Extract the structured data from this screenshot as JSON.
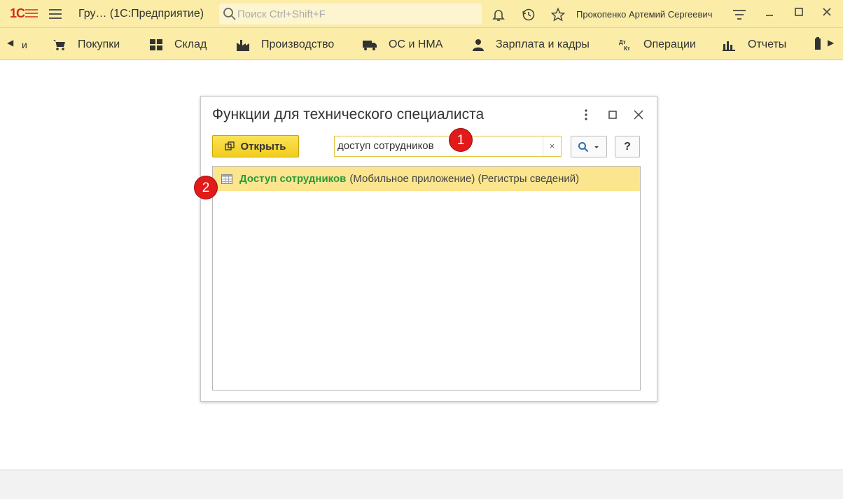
{
  "titlebar": {
    "logo": "1С",
    "app_title": "Гру…  (1С:Предприятие)",
    "search_placeholder": "Поиск Ctrl+Shift+F",
    "user_name": "Прокопенко Артемий Сергеевич"
  },
  "sections": {
    "items": [
      {
        "label": "и",
        "icon": "partial-icon"
      },
      {
        "label": "Покупки",
        "icon": "cart-icon"
      },
      {
        "label": "Склад",
        "icon": "warehouse-icon"
      },
      {
        "label": "Производство",
        "icon": "factory-icon"
      },
      {
        "label": "ОС и НМА",
        "icon": "truck-icon"
      },
      {
        "label": "Зарплата и кадры",
        "icon": "person-icon"
      },
      {
        "label": "Операции",
        "icon": "accounting-icon"
      },
      {
        "label": "Отчеты",
        "icon": "bar-chart-icon"
      }
    ]
  },
  "dialog": {
    "title": "Функции для технического специалиста",
    "open_button": "Открыть",
    "search_value": "доступ сотрудников",
    "clear_label": "×",
    "help_label": "?",
    "results": [
      {
        "name": "Доступ сотрудников",
        "description": "(Мобильное приложение) (Регистры сведений)"
      }
    ]
  },
  "badges": [
    "1",
    "2"
  ],
  "colors": {
    "title_bg": "#fbeda8",
    "accent_button": "#f5d22a",
    "result_highlight": "#fbe58e",
    "result_name": "#2a9a3b",
    "badge": "#e21a1a"
  }
}
